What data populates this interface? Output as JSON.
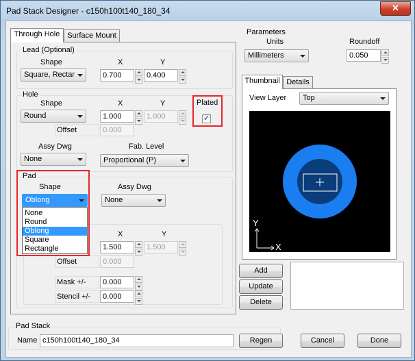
{
  "window": {
    "title": "Pad Stack Designer - c150h100t140_180_34",
    "close_glyph": "✕"
  },
  "tabs": {
    "through_hole": "Through Hole",
    "surface_mount": "Surface Mount"
  },
  "lead": {
    "group_label": "Lead (Optional)",
    "shape_label": "Shape",
    "x_label": "X",
    "y_label": "Y",
    "shape_value": "Square, Rectar",
    "x_value": "0.700",
    "y_value": "0.400"
  },
  "hole": {
    "group_label": "Hole",
    "shape_label": "Shape",
    "x_label": "X",
    "y_label": "Y",
    "shape_value": "Round",
    "x_value": "1.000",
    "y_value": "1.000",
    "plated_label": "Plated",
    "plated_checked": "✓",
    "offset_label": "Offset",
    "offset_value": "0.000",
    "assy_dwg_label": "Assy Dwg",
    "assy_dwg_value": "None",
    "fab_level_label": "Fab. Level",
    "fab_level_value": "Proportional (P)"
  },
  "pad": {
    "group_label": "Pad",
    "shape_label": "Shape",
    "shape_value": "Oblong",
    "assy_dwg_label": "Assy Dwg",
    "assy_dwg_value": "None",
    "shape_options": [
      "None",
      "Round",
      "Oblong",
      "Square",
      "Rectangle"
    ],
    "selected_option": "Oblong",
    "x_label": "X",
    "y_label": "Y",
    "x_value": "1.500",
    "y_value": "1.500",
    "offset_label": "Offset",
    "offset_value": "0.000",
    "mask_label": "Mask +/-",
    "mask_value": "0.000",
    "stencil_label": "Stencil +/-",
    "stencil_value": "0.000"
  },
  "pad_stack": {
    "group_label": "Pad Stack",
    "name_label": "Name",
    "name_value": "c150h100t140_180_34"
  },
  "parameters": {
    "group_label": "Parameters",
    "units_label": "Units",
    "units_value": "Millimeters",
    "roundoff_label": "Roundoff",
    "roundoff_value": "0.050"
  },
  "preview": {
    "tab_thumbnail": "Thumbnail",
    "tab_details": "Details",
    "view_layer_label": "View Layer",
    "view_layer_value": "Top",
    "axis_y": "Y",
    "axis_x": "X",
    "pad_color": "#1a7ef0",
    "hole_color": "#0b3c7c",
    "background": "#000000"
  },
  "buttons": {
    "add": "Add",
    "update": "Update",
    "delete": "Delete",
    "regen": "Regen",
    "cancel": "Cancel",
    "done": "Done"
  }
}
